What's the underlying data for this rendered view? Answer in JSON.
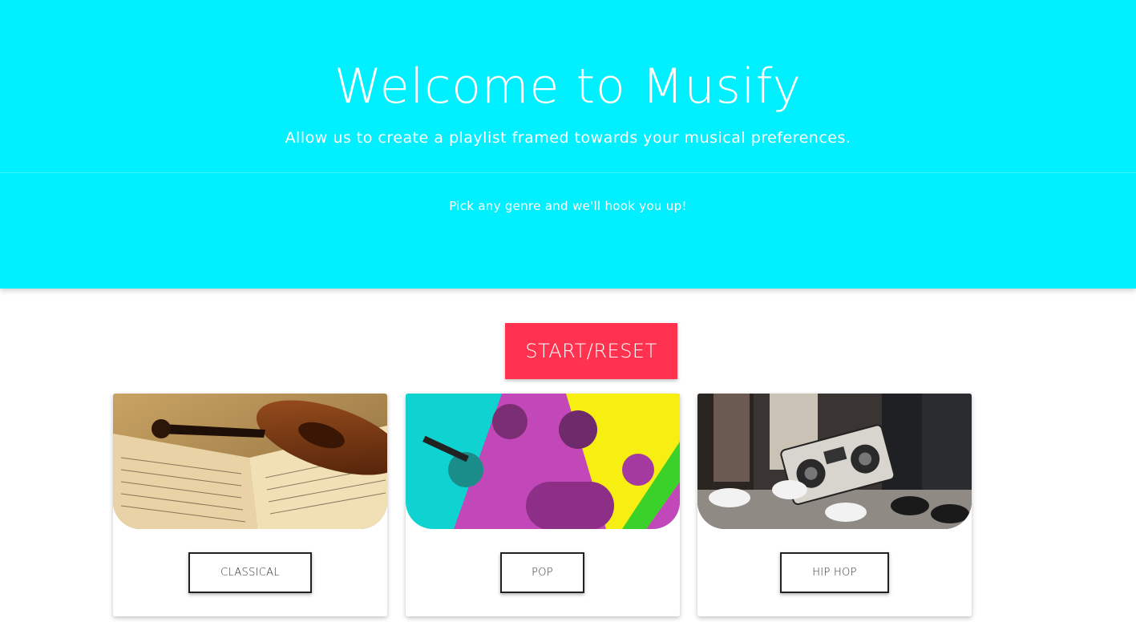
{
  "hero": {
    "title": "Welcome to Musify",
    "subtitle": "Allow us to create a playlist framed towards your musical preferences.",
    "tagline": "Pick any genre and we'll hook you up!",
    "background_color": "#00f0ff"
  },
  "controls": {
    "start_reset_label": "START/RESET",
    "accent_color": "#ff334f"
  },
  "genres": [
    {
      "label": "CLASSICAL",
      "image": "violin-sheet-music-photo"
    },
    {
      "label": "POP",
      "image": "pop-artists-collage-photo"
    },
    {
      "label": "HIP HOP",
      "image": "boombox-sneakers-photo"
    }
  ]
}
